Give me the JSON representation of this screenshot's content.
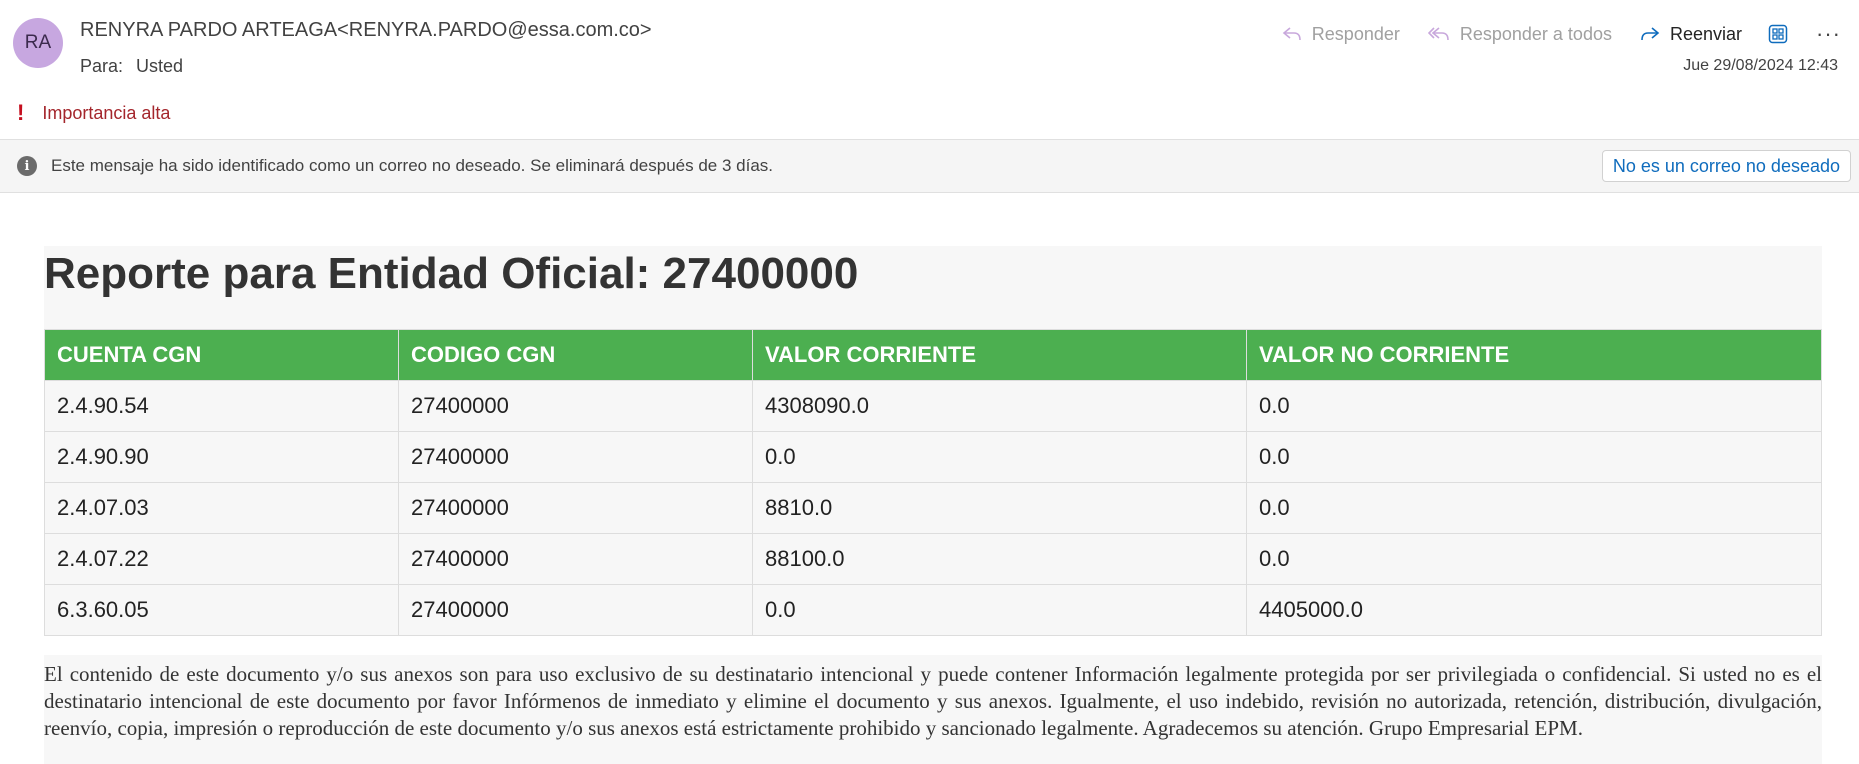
{
  "email": {
    "avatar_initials": "RA",
    "sender": "RENYRA PARDO ARTEAGA<RENYRA.PARDO@essa.com.co>",
    "to_label": "Para:",
    "to_value": "Usted",
    "date": "Jue 29/08/2024 12:43",
    "importance": "Importancia alta"
  },
  "actions": {
    "reply": "Responder",
    "reply_all": "Responder a todos",
    "forward": "Reenviar",
    "more": "···"
  },
  "junk_bar": {
    "message": "Este mensaje ha sido identificado como un correo no deseado. Se eliminará después de 3 días.",
    "button": "No es un correo no deseado"
  },
  "report": {
    "title": "Reporte para Entidad Oficial: 27400000",
    "columns": [
      "CUENTA CGN",
      "CODIGO CGN",
      "VALOR CORRIENTE",
      "VALOR NO CORRIENTE"
    ],
    "rows": [
      [
        "2.4.90.54",
        "27400000",
        "4308090.0",
        "0.0"
      ],
      [
        "2.4.90.90",
        "27400000",
        "0.0",
        "0.0"
      ],
      [
        "2.4.07.03",
        "27400000",
        "8810.0",
        "0.0"
      ],
      [
        "2.4.07.22",
        "27400000",
        "88100.0",
        "0.0"
      ],
      [
        "6.3.60.05",
        "27400000",
        "0.0",
        "4405000.0"
      ]
    ],
    "header_color": "#4caf50"
  },
  "disclaimer": "El contenido de este documento y/o sus anexos son para uso exclusivo de su destinatario intencional y puede contener Información legalmente protegida por ser privilegiada o confidencial. Si usted no es el destinatario intencional de este documento por favor Infórmenos de inmediato y elimine el documento y sus anexos. Igualmente, el uso indebido, revisión no autorizada, retención, distribución, divulgación, reenvío, copia, impresión o reproducción de este documento y/o sus anexos está estrictamente prohibido y sancionado legalmente. Agradecemos su atención. Grupo Empresarial EPM."
}
